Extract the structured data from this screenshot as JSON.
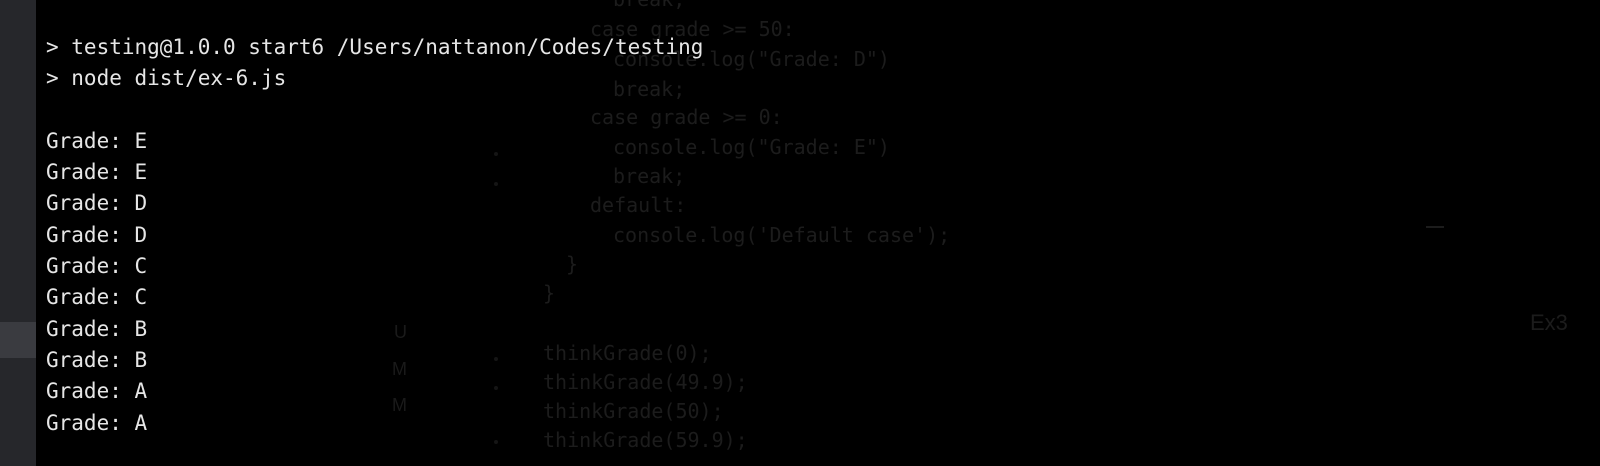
{
  "terminal": {
    "header_lines": [
      "> testing@1.0.0 start6 /Users/nattanon/Codes/testing",
      "> node dist/ex-6.js"
    ],
    "grades": [
      "Grade: E",
      "Grade: E",
      "Grade: D",
      "Grade: D",
      "Grade: C",
      "Grade: C",
      "Grade: B",
      "Grade: B",
      "Grade: A",
      "Grade: A"
    ]
  },
  "background_editor": {
    "code_lines": [
      "break;",
      "case grade >= 50:",
      "console.log(\"Grade: D\")",
      "break;",
      "case grade >= 0:",
      "console.log(\"Grade: E\")",
      "break;",
      "default:",
      "console.log('Default case');",
      "}",
      "}",
      "thinkGrade(0);",
      "thinkGrade(49.9);",
      "thinkGrade(50);",
      "thinkGrade(59.9);"
    ],
    "side_letters": [
      "U",
      "M",
      "M"
    ],
    "right_label": "Ex3"
  }
}
